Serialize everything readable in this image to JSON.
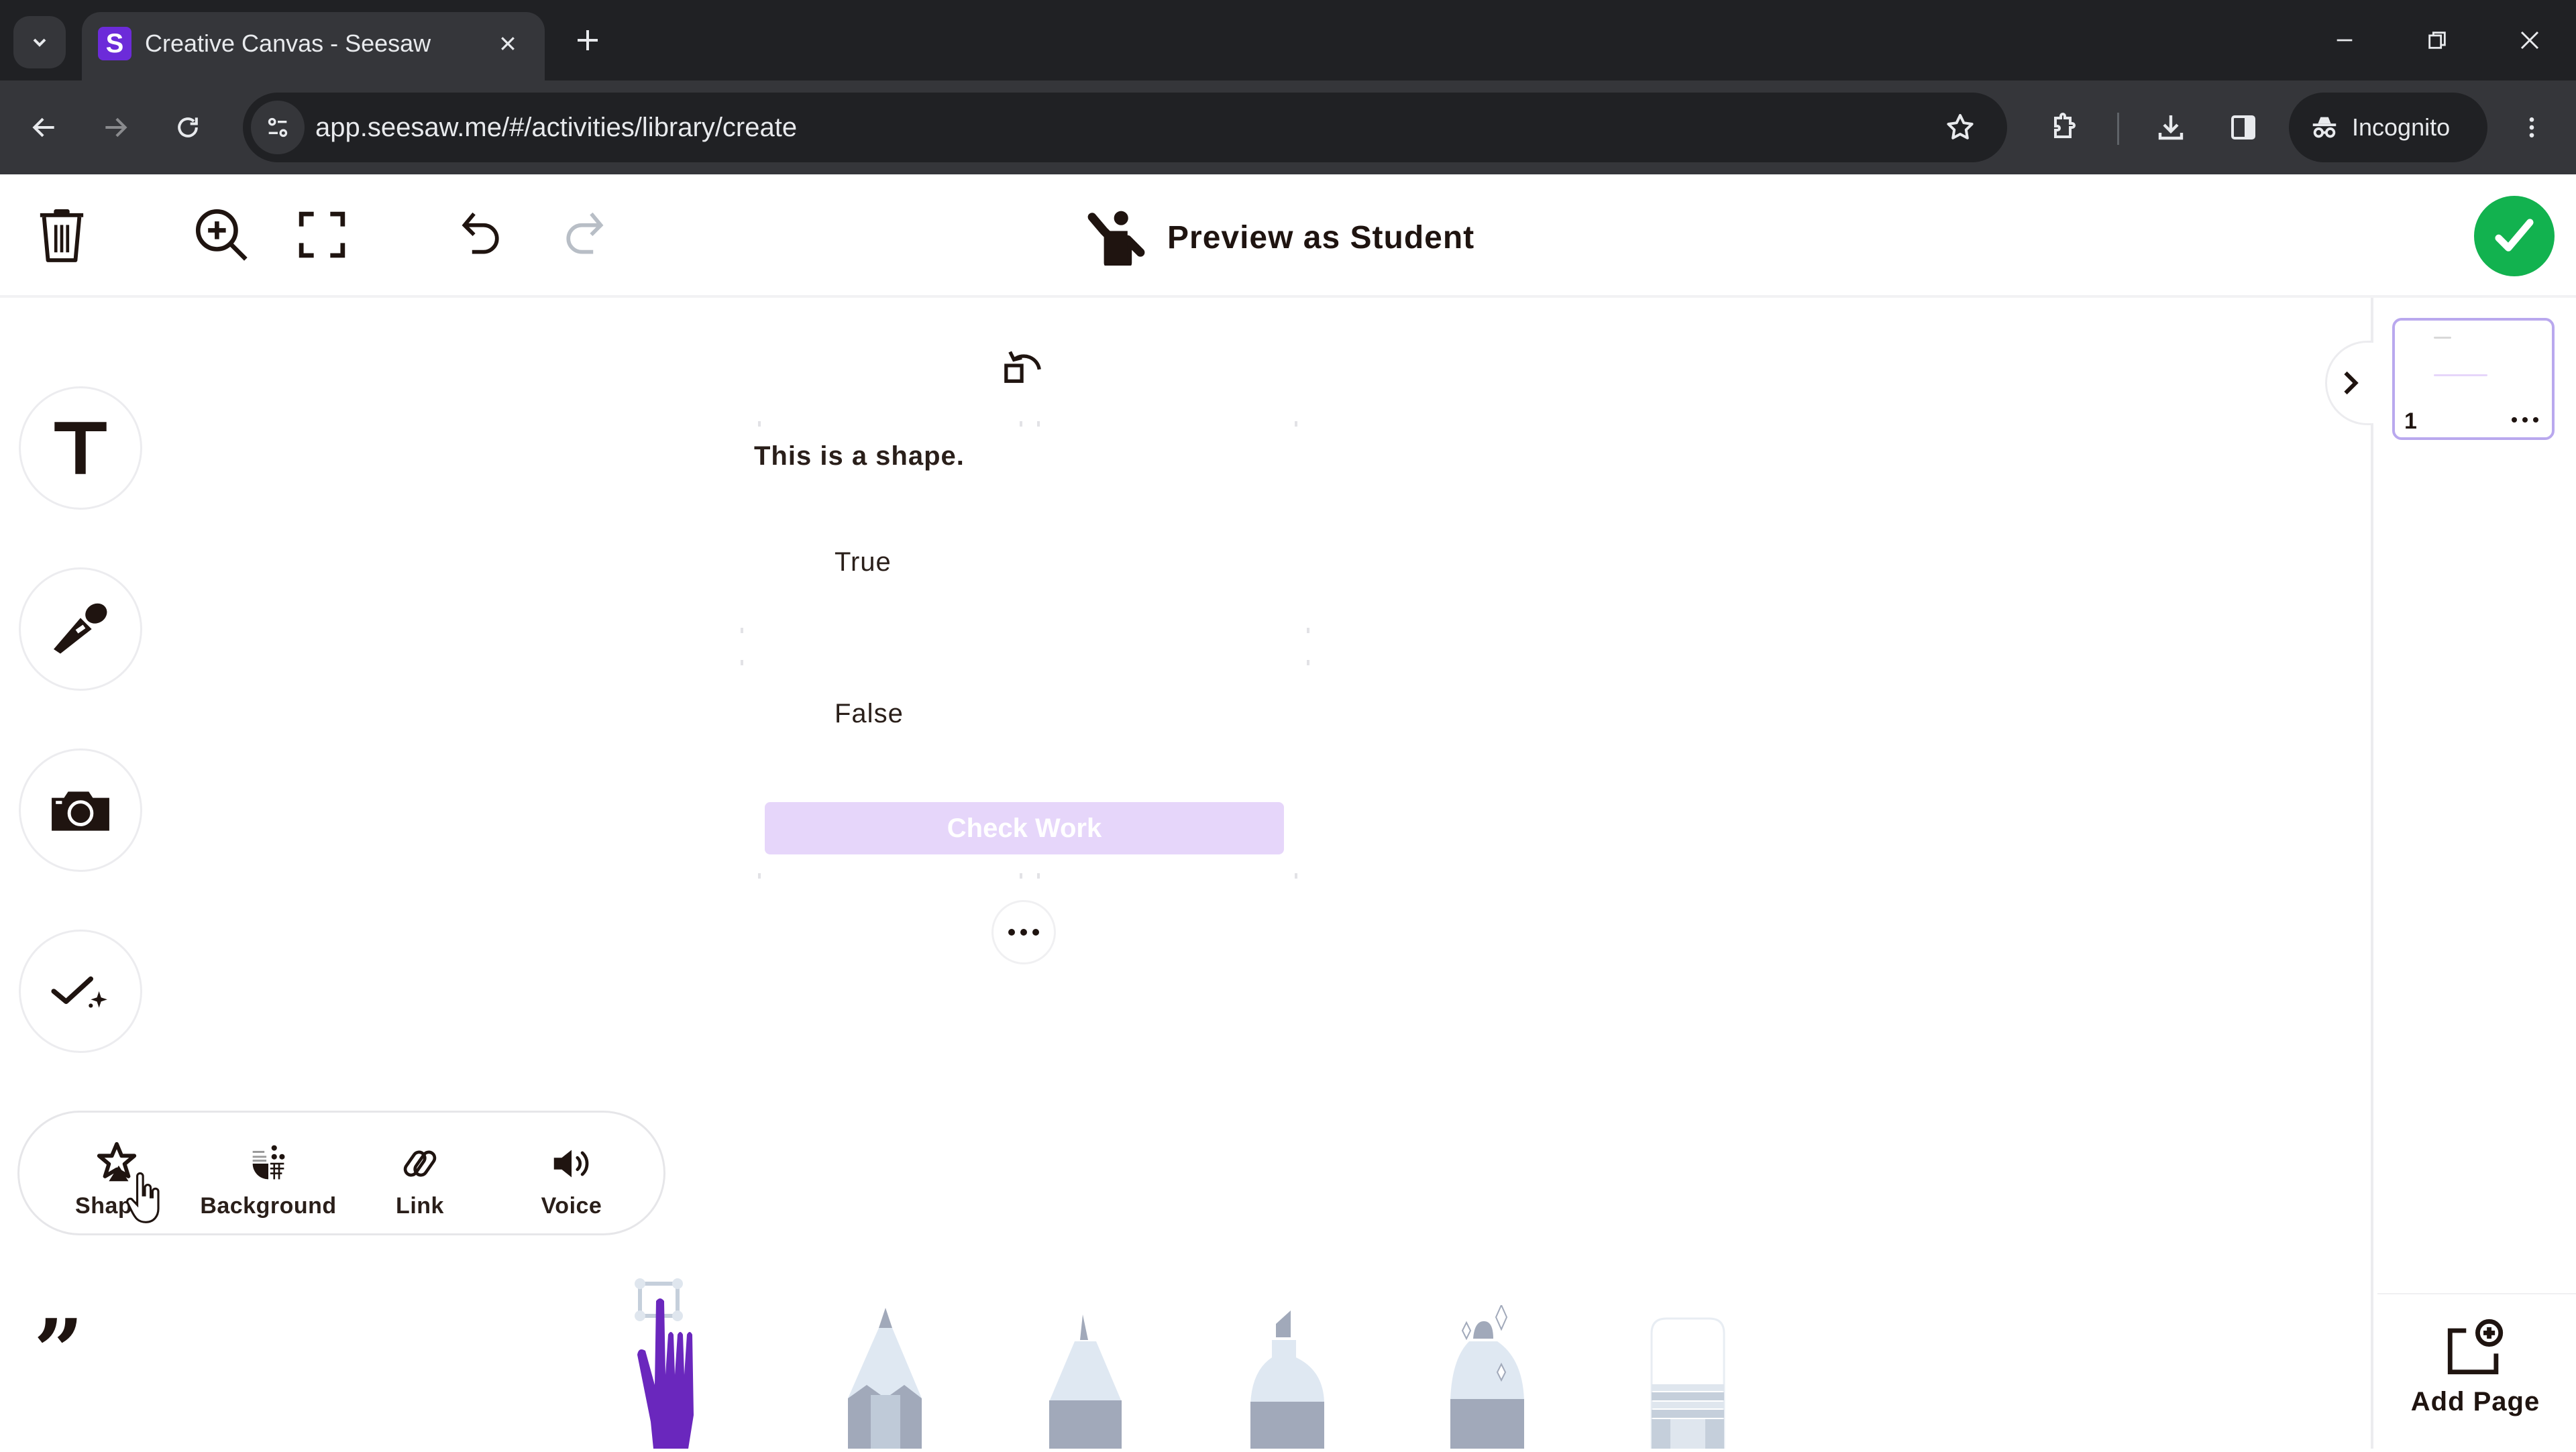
{
  "browser": {
    "tab": {
      "title": "Creative Canvas - Seesaw",
      "favicon": "S"
    },
    "url": "app.seesaw.me/#/activities/library/create",
    "profile_label": "Incognito",
    "icons": [
      "tab-list-icon",
      "close-tab-icon",
      "new-tab-icon",
      "minimize-icon",
      "restore-icon",
      "close-window-icon",
      "back-icon",
      "forward-icon",
      "reload-icon",
      "site-info-icon",
      "bookmark-star-icon",
      "extensions-icon",
      "downloads-icon",
      "side-panel-icon",
      "incognito-icon",
      "menu-kebab-icon"
    ]
  },
  "header": {
    "preview_label": "Preview as Student",
    "icons": [
      "trash-icon",
      "zoom-in-icon",
      "fit-screen-icon",
      "undo-icon",
      "redo-icon",
      "student-icon",
      "checkmark-icon"
    ]
  },
  "left_tools": {
    "items": [
      {
        "name": "text",
        "icon": "text-T-icon"
      },
      {
        "name": "microphone",
        "icon": "microphone-icon"
      },
      {
        "name": "camera",
        "icon": "camera-icon"
      },
      {
        "name": "check-sparkle",
        "icon": "check-sparkle-icon"
      }
    ],
    "more_tools": [
      {
        "label": "Shapes",
        "icon": "star-shapes-icon"
      },
      {
        "label": "Background",
        "icon": "background-icon"
      },
      {
        "label": "Link",
        "icon": "link-icon"
      },
      {
        "label": "Voice",
        "icon": "speaker-icon"
      }
    ],
    "quote_glyph": "”"
  },
  "canvas": {
    "question": "This is a shape.",
    "options": [
      "True",
      "False"
    ],
    "check_work_label": "Check Work",
    "colors": {
      "check_work_bg": "#e6d6fa",
      "accent_purple": "#6c2bd9",
      "done_green": "#12b24f"
    }
  },
  "pages": {
    "items": [
      {
        "number": "1"
      }
    ],
    "add_page_label": "Add Page"
  },
  "drawing_tools": [
    {
      "name": "select-hand",
      "active": true
    },
    {
      "name": "pencil",
      "active": false
    },
    {
      "name": "pen",
      "active": false
    },
    {
      "name": "marker",
      "active": false
    },
    {
      "name": "glitter-pen",
      "active": false
    },
    {
      "name": "eraser",
      "active": false
    }
  ]
}
